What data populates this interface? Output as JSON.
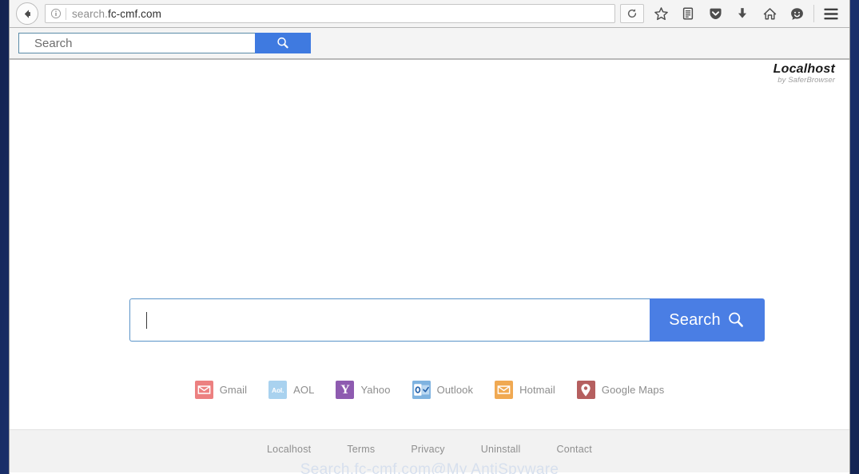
{
  "browser": {
    "back_icon": "back-arrow-icon",
    "identity_icon": "info-circle-icon",
    "url_scheme_host": "search.",
    "url_domain": "fc-cmf.com",
    "url_full": "search.fc-cmf.com",
    "reload_icon": "reload-icon",
    "toolbar_icons": [
      {
        "name": "bookmark-star-icon",
        "title": "Bookmark"
      },
      {
        "name": "library-icon",
        "title": "Library"
      },
      {
        "name": "pocket-shield-icon",
        "title": "Save to Pocket"
      },
      {
        "name": "download-arrow-icon",
        "title": "Downloads"
      },
      {
        "name": "home-icon",
        "title": "Home"
      },
      {
        "name": "sync-smiley-icon",
        "title": "Account"
      },
      {
        "name": "hamburger-menu-icon",
        "title": "Open menu"
      }
    ]
  },
  "extension_bar": {
    "search_placeholder": "Search",
    "search_value": "",
    "button_icon": "magnifier-icon",
    "accent_color": "#3f7ae0"
  },
  "page": {
    "brand": {
      "name": "Localhost",
      "tagline": "by SaferBrowser"
    },
    "main_search": {
      "value": "",
      "placeholder": "",
      "button_label": "Search",
      "button_icon": "magnifier-icon",
      "button_color": "#4a7ee4",
      "border_color": "#5a93c8"
    },
    "shortcuts": [
      {
        "id": "gmail",
        "label": "Gmail",
        "icon": "gmail-envelope-icon",
        "color": "#ec8080"
      },
      {
        "id": "aol",
        "label": "AOL",
        "icon": "aol-wordmark-icon",
        "color": "#a9d2ef",
        "glyph": "Aol."
      },
      {
        "id": "yahoo",
        "label": "Yahoo",
        "icon": "yahoo-y-icon",
        "color": "#8e5bb0",
        "glyph": "Y"
      },
      {
        "id": "outlook",
        "label": "Outlook",
        "icon": "outlook-o-icon",
        "color": "#7fb3e0"
      },
      {
        "id": "hotmail",
        "label": "Hotmail",
        "icon": "hotmail-envelope-icon",
        "color": "#f0a952"
      },
      {
        "id": "googlemaps",
        "label": "Google Maps",
        "icon": "map-pin-icon",
        "color": "#b55f5f"
      }
    ],
    "footer": {
      "links": [
        {
          "id": "localhost",
          "label": "Localhost"
        },
        {
          "id": "terms",
          "label": "Terms"
        },
        {
          "id": "privacy",
          "label": "Privacy"
        },
        {
          "id": "uninstall",
          "label": "Uninstall"
        },
        {
          "id": "contact",
          "label": "Contact"
        }
      ],
      "watermark": "Search.fc-cmf.com@My AntiSpyware"
    }
  }
}
